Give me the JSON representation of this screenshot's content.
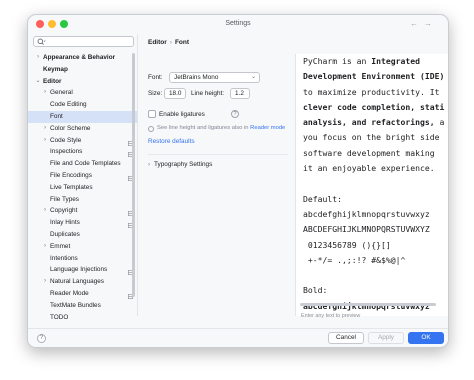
{
  "window": {
    "title": "Settings"
  },
  "search": {
    "placeholder": ""
  },
  "sidebar": {
    "items": [
      {
        "label": "Appearance & Behavior",
        "depth": 0,
        "expander": "collapsed",
        "bold": true
      },
      {
        "label": "Keymap",
        "depth": 0,
        "expander": "none",
        "bold": true
      },
      {
        "label": "Editor",
        "depth": 0,
        "expander": "expanded",
        "bold": true
      },
      {
        "label": "General",
        "depth": 1,
        "expander": "collapsed"
      },
      {
        "label": "Code Editing",
        "depth": 1,
        "expander": "none"
      },
      {
        "label": "Font",
        "depth": 1,
        "expander": "none",
        "selected": true
      },
      {
        "label": "Color Scheme",
        "depth": 1,
        "expander": "collapsed"
      },
      {
        "label": "Code Style",
        "depth": 1,
        "expander": "collapsed",
        "project": true
      },
      {
        "label": "Inspections",
        "depth": 1,
        "expander": "none",
        "project": true
      },
      {
        "label": "File and Code Templates",
        "depth": 1,
        "expander": "none"
      },
      {
        "label": "File Encodings",
        "depth": 1,
        "expander": "none",
        "project": true
      },
      {
        "label": "Live Templates",
        "depth": 1,
        "expander": "none"
      },
      {
        "label": "File Types",
        "depth": 1,
        "expander": "none"
      },
      {
        "label": "Copyright",
        "depth": 1,
        "expander": "collapsed",
        "project": true
      },
      {
        "label": "Inlay Hints",
        "depth": 1,
        "expander": "none",
        "project": true
      },
      {
        "label": "Duplicates",
        "depth": 1,
        "expander": "none"
      },
      {
        "label": "Emmet",
        "depth": 1,
        "expander": "collapsed"
      },
      {
        "label": "Intentions",
        "depth": 1,
        "expander": "none"
      },
      {
        "label": "Language Injections",
        "depth": 1,
        "expander": "none",
        "project": true
      },
      {
        "label": "Natural Languages",
        "depth": 1,
        "expander": "collapsed"
      },
      {
        "label": "Reader Mode",
        "depth": 1,
        "expander": "none",
        "project": true
      },
      {
        "label": "TextMate Bundles",
        "depth": 1,
        "expander": "none"
      },
      {
        "label": "TODO",
        "depth": 1,
        "expander": "none"
      }
    ]
  },
  "breadcrumb": {
    "parent": "Editor",
    "separator": "›",
    "current": "Font"
  },
  "font": {
    "label": "Font:",
    "value": "JetBrains Mono",
    "size_label": "Size:",
    "size_value": "18.0",
    "line_height_label": "Line height:",
    "line_height_value": "1.2",
    "ligatures_label": "Enable ligatures",
    "ligatures_checked": false,
    "note_text": "See line height and ligatures also in",
    "note_link": "Reader mode",
    "restore_label": "Restore defaults",
    "typography_label": "Typography Settings"
  },
  "preview": {
    "lines": [
      [
        {
          "t": "PyCharm is an "
        },
        {
          "t": "Integrated",
          "b": true
        }
      ],
      [
        {
          "t": "Development Environment (IDE)",
          "b": true
        }
      ],
      [
        {
          "t": "to maximize productivity. It"
        }
      ],
      [
        {
          "t": "clever code completion, stati",
          "b": true
        }
      ],
      [
        {
          "t": "analysis, and refactorings,",
          "b": true
        },
        {
          "t": " a"
        }
      ],
      [
        {
          "t": "you focus on the bright side"
        }
      ],
      [
        {
          "t": "software development making"
        }
      ],
      [
        {
          "t": "it an enjoyable experience."
        }
      ],
      [
        {
          "t": ""
        }
      ],
      [
        {
          "t": "Default:"
        }
      ],
      [
        {
          "t": "abcdefghijklmnopqrstuvwxyz"
        }
      ],
      [
        {
          "t": "ABCDEFGHIJKLMNOPQRSTUVWXYZ"
        }
      ],
      [
        {
          "t": " 0123456789 (){}[]"
        }
      ],
      [
        {
          "t": " +-*/= .,;:!? #&$%@|^"
        }
      ],
      [
        {
          "t": ""
        }
      ],
      [
        {
          "t": "Bold:"
        }
      ],
      [
        {
          "t": "abcdefghijklmnopqrstuvwxyz",
          "b": true
        }
      ]
    ],
    "hint": "Enter any text to preview"
  },
  "buttons": {
    "cancel": "Cancel",
    "apply": "Apply",
    "ok": "OK",
    "help": "?"
  },
  "colors": {
    "accent": "#3574f0",
    "selection": "#d5e1f7"
  }
}
